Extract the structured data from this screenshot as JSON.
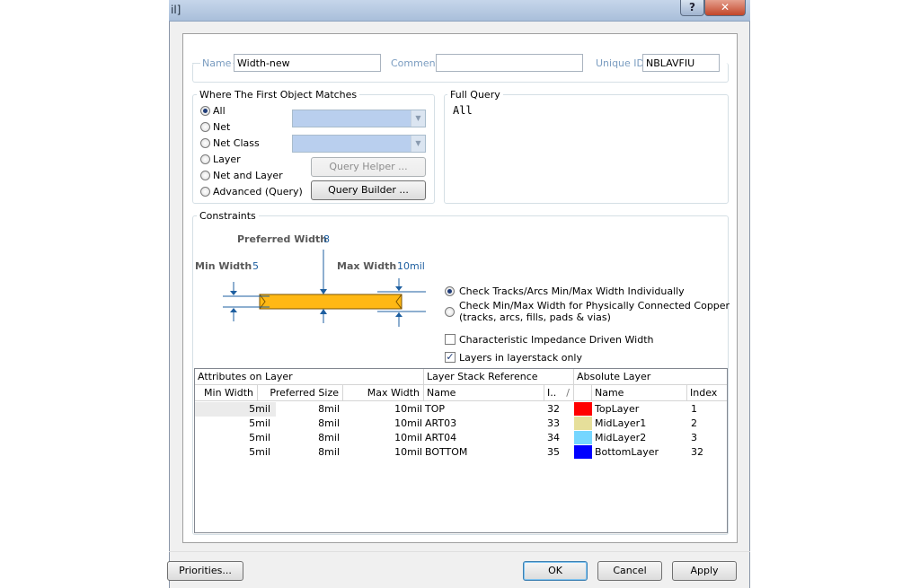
{
  "window": {
    "title": "il]"
  },
  "titlebar": {
    "help_glyph": "?",
    "close_glyph": "✕"
  },
  "fields": {
    "name_label": "Name",
    "name_value": "Width-new",
    "comment_label": "Comment",
    "comment_value": "",
    "uid_label": "Unique ID",
    "uid_value": "NBLAVFIU"
  },
  "match": {
    "title": "Where The First Object Matches",
    "options": [
      "All",
      "Net",
      "Net Class",
      "Layer",
      "Net and Layer",
      "Advanced (Query)"
    ],
    "selected": "All",
    "query_helper": "Query Helper ...",
    "query_builder": "Query Builder ..."
  },
  "full_query": {
    "title": "Full Query",
    "text": "All"
  },
  "constraints": {
    "title": "Constraints",
    "preferred_label": "Preferred Width",
    "preferred_value": "8",
    "min_label": "Min Width",
    "min_value": "5",
    "max_label": "Max Width",
    "max_value": "10mil",
    "check_individually": "Check Tracks/Arcs Min/Max Width Individually",
    "check_copper_line1": "Check Min/Max Width for Physically Connected Copper",
    "check_copper_line2": "(tracks, arcs, fills, pads & vias)",
    "impedance": "Characteristic Impedance Driven Width",
    "layers_only": "Layers in layerstack only",
    "track_color": "#ffb814"
  },
  "table": {
    "group_attributes": "Attributes on Layer",
    "group_stack": "Layer Stack Reference",
    "group_absolute": "Absolute Layer",
    "columns": [
      "Min Width",
      "Preferred Size",
      "Max Width",
      "Name",
      "I..",
      "Name",
      "Index"
    ],
    "sort_glyph": "/",
    "rows": [
      {
        "min": "5mil",
        "pref": "8mil",
        "max": "10mil",
        "stack_name": "TOP",
        "stack_index": "32",
        "color": "#ff0000",
        "layer": "TopLayer",
        "index": "1"
      },
      {
        "min": "5mil",
        "pref": "8mil",
        "max": "10mil",
        "stack_name": "ART03",
        "stack_index": "33",
        "color": "#e6df9a",
        "layer": "MidLayer1",
        "index": "2"
      },
      {
        "min": "5mil",
        "pref": "8mil",
        "max": "10mil",
        "stack_name": "ART04",
        "stack_index": "34",
        "color": "#75d6ff",
        "layer": "MidLayer2",
        "index": "3"
      },
      {
        "min": "5mil",
        "pref": "8mil",
        "max": "10mil",
        "stack_name": "BOTTOM",
        "stack_index": "35",
        "color": "#0000ff",
        "layer": "BottomLayer",
        "index": "32"
      }
    ]
  },
  "footer": {
    "priorities": "Priorities...",
    "ok": "OK",
    "cancel": "Cancel",
    "apply": "Apply"
  }
}
